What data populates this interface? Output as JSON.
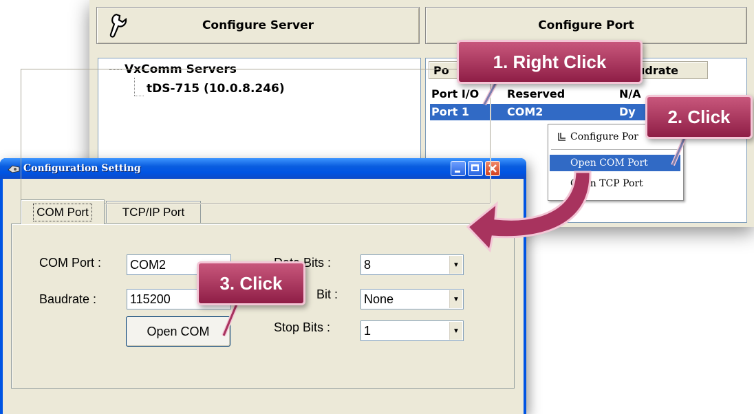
{
  "server_window": {
    "configure_server_label": "Configure Server",
    "configure_port_label": "Configure Port",
    "tree_root": "VxComm Servers",
    "tree_child": "tDS-715  (10.0.8.246)"
  },
  "port_list": {
    "col_port": "Po",
    "col_baudrate": "udrate",
    "rows": [
      {
        "port": "Port I/O",
        "com": "Reserved",
        "baud": "N/A"
      },
      {
        "port": "Port 1",
        "com": "COM2",
        "baud": "Dy"
      }
    ]
  },
  "context_menu": {
    "items": [
      "Configure Por",
      "Open COM Port",
      "Open TCP Port"
    ],
    "selected": "Open COM Port"
  },
  "dialog": {
    "title": "Configuration Setting",
    "tabs": [
      "COM Port",
      "TCP/IP Port"
    ],
    "active_tab": "COM Port",
    "com_port_label": "COM Port :",
    "com_port_value": "COM2",
    "baudrate_label": "Baudrate :",
    "baudrate_value": "115200",
    "data_bits_label": "Data Bits :",
    "data_bits_value": "8",
    "parity_label": "Bit :",
    "parity_value": "None",
    "stop_bits_label": "Stop Bits :",
    "stop_bits_value": "1",
    "open_com_label": "Open COM"
  },
  "callouts": {
    "step1": "1. Right Click",
    "step2": "2. Click",
    "step3": "3. Click"
  },
  "colors": {
    "callout": "#a8335e",
    "selection": "#316ac5",
    "titlebar": "#0054e3"
  }
}
